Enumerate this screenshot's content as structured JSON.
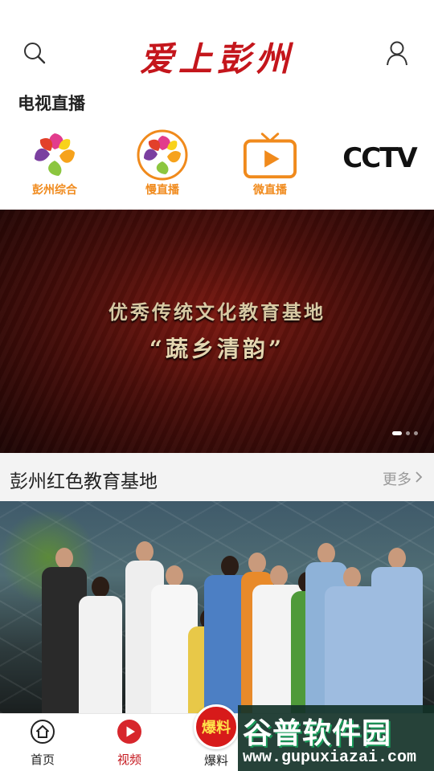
{
  "header": {
    "logo_text": "爱上彭州",
    "search_icon": "search-icon",
    "user_icon": "user-icon"
  },
  "live_section": {
    "title": "电视直播",
    "channels": [
      {
        "label": "彭州综合",
        "icon": "flower-logo"
      },
      {
        "label": "慢直播",
        "icon": "flower-ring-logo"
      },
      {
        "label": "微直播",
        "icon": "tv-play-logo"
      },
      {
        "label": "",
        "logo_text": "CCTV"
      }
    ]
  },
  "banner": {
    "line1": "优秀传统文化教育基地",
    "line2": "“蔬乡清韵”",
    "slide_count": 3,
    "active_slide": 1
  },
  "section": {
    "title": "彭州红色教育基地",
    "more_label": "更多"
  },
  "nav": {
    "items": [
      {
        "label": "首页",
        "icon": "home-icon"
      },
      {
        "label": "视频",
        "icon": "play-icon",
        "active": true
      },
      {
        "label": "爆料",
        "badge": "爆料"
      }
    ]
  },
  "watermark": {
    "title": "谷普软件园",
    "url": "www.gupuxiazai.com"
  },
  "colors": {
    "brand_red": "#c4161c",
    "channel_orange": "#f08a1c"
  }
}
